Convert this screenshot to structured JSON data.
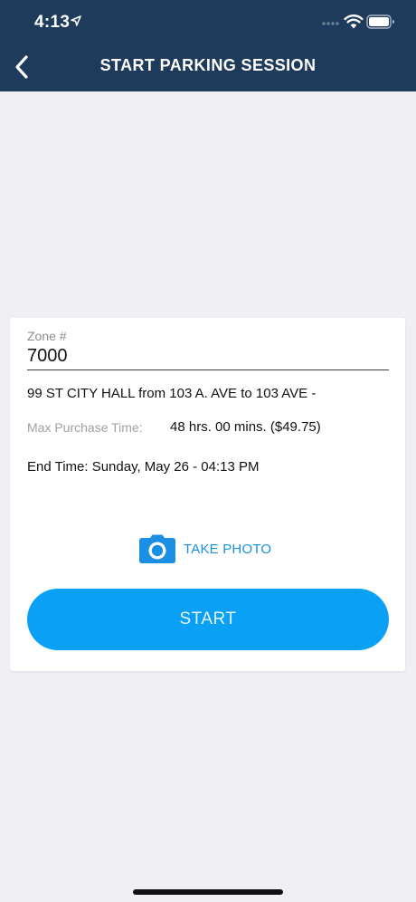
{
  "status_bar": {
    "time": "4:13"
  },
  "nav": {
    "title": "START PARKING SESSION",
    "back_icon": "chevron-left-icon"
  },
  "form": {
    "zone_label": "Zone #",
    "zone_value": "7000",
    "address": "99 ST CITY HALL from 103 A.  AVE to 103 AVE -",
    "max_purchase_label": "Max Purchase Time:",
    "max_purchase_value": "48 hrs. 00 mins. ($49.75)",
    "end_time": "End Time: Sunday, May 26 - 04:13 PM",
    "take_photo_label": "TAKE PHOTO",
    "camera_icon": "camera-icon",
    "start_label": "START"
  },
  "colors": {
    "nav_bg": "#1e3b5c",
    "page_bg": "#efeff4",
    "accent": "#0aa0f5",
    "link": "#1a8fe3"
  }
}
